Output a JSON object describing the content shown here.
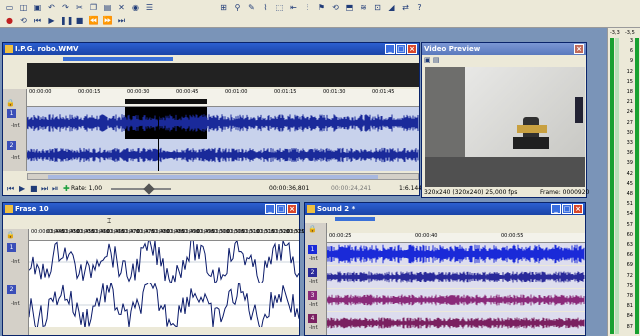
{
  "toolbar": {
    "icons": [
      "new-icon",
      "open-icon",
      "save-icon",
      "undo-icon",
      "redo-icon",
      "cut-icon",
      "copy-icon",
      "paste-icon",
      "delete-icon",
      "render-icon",
      "properties-icon",
      "snap-icon",
      "zoom-icon",
      "edit-tool-icon",
      "envelope-icon",
      "select-icon",
      "trim-icon",
      "split-icon",
      "marker-icon",
      "loop-icon",
      "region-icon",
      "ripple-icon",
      "lock-icon",
      "fade-icon",
      "sync-icon",
      "help-icon"
    ],
    "transport_icons": [
      "record-icon",
      "loop-icon",
      "play-from-start-icon",
      "play-icon",
      "pause-icon",
      "stop-icon",
      "rewind-icon",
      "fast-forward-icon",
      "go-end-icon"
    ]
  },
  "main_window": {
    "title": "I.P.G. robo.WMV",
    "ruler": [
      "00:00:00",
      "00:00:15",
      "00:00:30",
      "00:00:45",
      "00:01:00",
      "00:01:15",
      "00:01:30",
      "00:01:45"
    ],
    "tracks": [
      {
        "num": "1",
        "db": "-Inf."
      },
      {
        "num": "2",
        "db": "-Inf."
      }
    ],
    "rate_label": "Rate: 1,00",
    "time_start": "00:00:36,801",
    "time_end": "00:00:24,241",
    "ratio": "1:6.144"
  },
  "preview": {
    "title": "Video Preview",
    "info": "320x240  (320x240)  25,000 fps",
    "frame": "Frame: 0000920"
  },
  "frase_window": {
    "title": "Frase 10",
    "ruler": [
      "00:00:03,445",
      "00:00:03,450",
      "00:00:03,455",
      "00:00:03,460",
      "00:00:03,465",
      "00:00:03,470",
      "00:00:03,475",
      "00:00:03,480",
      "00:00:03,485",
      "00:00:03,490",
      "00:00:03,495",
      "00:00:03,500",
      "00:00:03,505",
      "00:00:03,510",
      "00:00:03,515",
      "00:00:03,520",
      "00:00:03,525",
      "00:00:03,530"
    ],
    "tracks": [
      {
        "num": "1",
        "db": "-Inf."
      },
      {
        "num": "2",
        "db": "-Inf."
      }
    ]
  },
  "sound_window": {
    "title": "Sound 2 *",
    "ruler": [
      "00:00:25",
      "00:00:40",
      "00:00:55"
    ],
    "tracks": [
      {
        "num": "1",
        "db": "-Inf."
      },
      {
        "num": "2",
        "db": "-Inf."
      },
      {
        "num": "3",
        "db": "-Inf."
      },
      {
        "num": "4",
        "db": "-Inf."
      }
    ],
    "colors": [
      "#1a2ad8",
      "#2a2a9a",
      "#8a2a7a",
      "#7a2060"
    ]
  },
  "meter": {
    "top_labels": [
      "-3,3",
      "-3,5"
    ],
    "inf_labels": [
      "-Inf.",
      "-Inf."
    ],
    "scale": [
      "3",
      "6",
      "9",
      "12",
      "15",
      "18",
      "21",
      "24",
      "27",
      "30",
      "33",
      "36",
      "39",
      "42",
      "45",
      "48",
      "51",
      "54",
      "57",
      "60",
      "63",
      "66",
      "69",
      "72",
      "75",
      "78",
      "81",
      "84",
      "87"
    ]
  }
}
